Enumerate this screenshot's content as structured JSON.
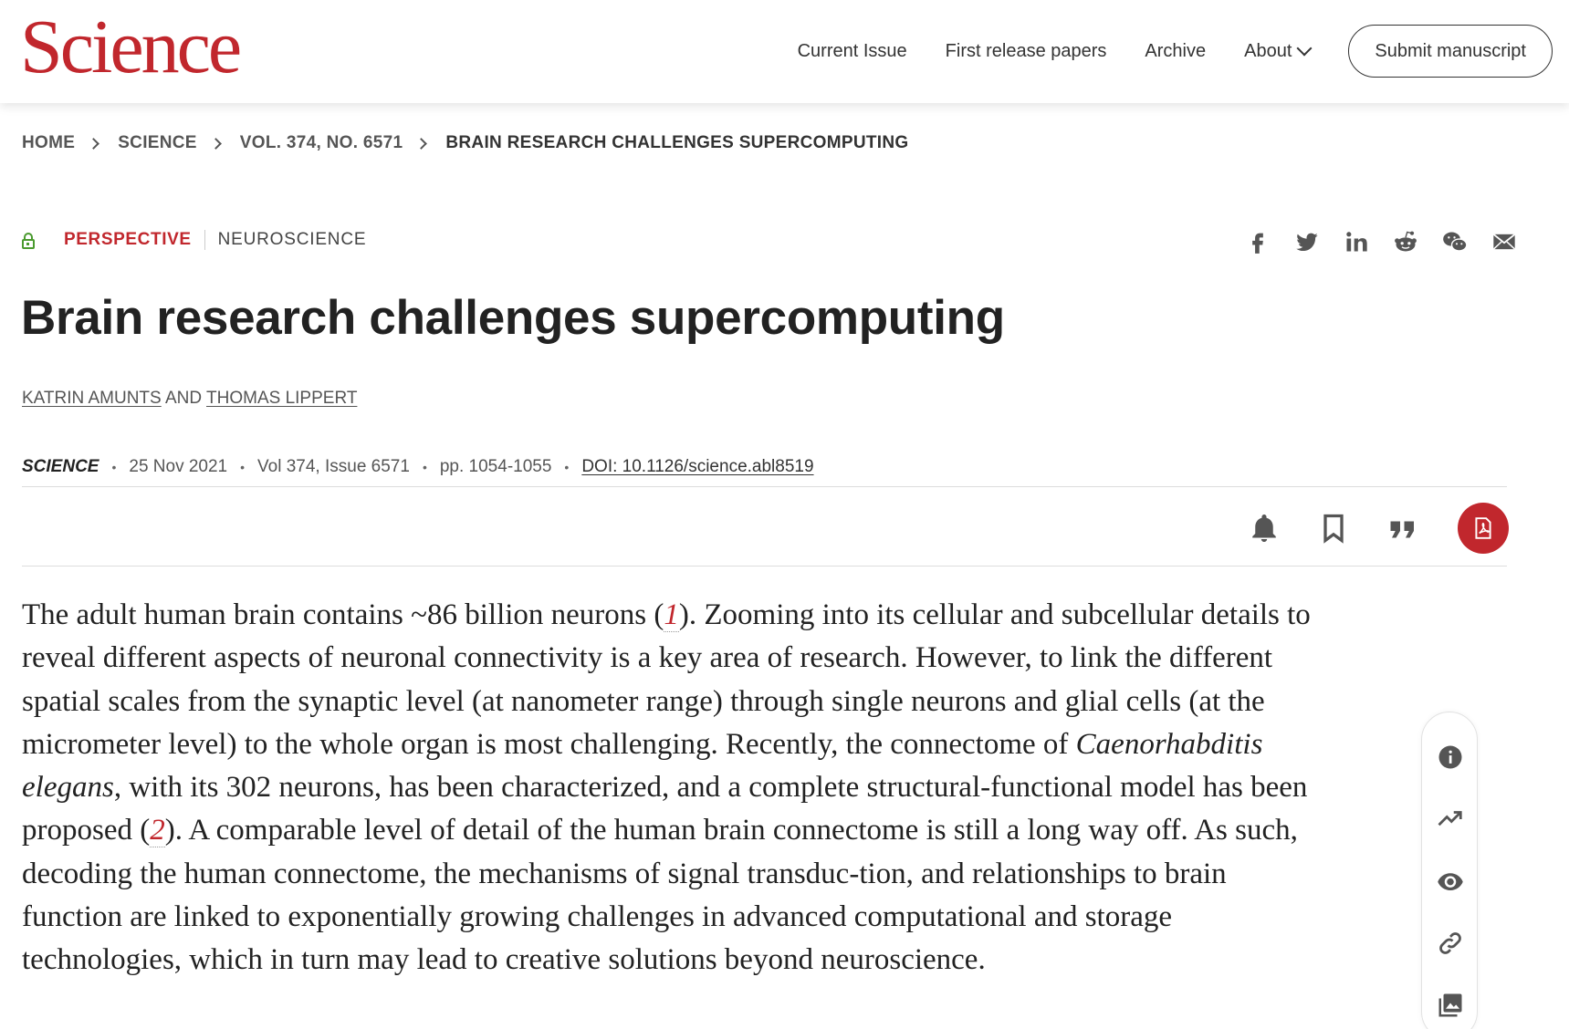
{
  "header": {
    "logo_text": "Science",
    "nav": [
      {
        "label": "Current Issue"
      },
      {
        "label": "First release papers"
      },
      {
        "label": "Archive"
      },
      {
        "label": "About"
      }
    ],
    "submit_label": "Submit manuscript"
  },
  "breadcrumb": {
    "items": [
      "HOME",
      "SCIENCE",
      "VOL. 374, NO. 6571",
      "BRAIN RESEARCH CHALLENGES SUPERCOMPUTING"
    ]
  },
  "article": {
    "type": "PERSPECTIVE",
    "subject": "NEUROSCIENCE",
    "title": "Brain research challenges supercomputing",
    "authors": [
      "KATRIN AMUNTS",
      "THOMAS LIPPERT"
    ],
    "author_joiner": "AND",
    "journal": "SCIENCE",
    "date": "25 Nov 2021",
    "volume_issue": "Vol 374, Issue 6571",
    "pages": "pp. 1054-1055",
    "doi": "DOI: 10.1126/science.abl8519",
    "abstract": {
      "p1": "The adult human brain contains ~86 billion neurons (",
      "ref1": "1",
      "p2": "). Zooming into its cellular and subcellular details to reveal different aspects of neuronal connectivity is a key area of research. However, to link the different spatial scales from the synaptic level (at nanometer range) through single neurons and glial cells (at the micrometer level) to the whole organ is most challenging. Recently, the connectome of ",
      "species": "Caenorhabditis elegans",
      "p3": ", with its 302 neurons, has been characterized, and a complete structural-functional model has been proposed (",
      "ref2": "2",
      "p4": "). A comparable level of detail of the human brain connectome is still a long way off. As such, decoding the human connectome, the mechanisms of signal transduc-tion, and relationships to brain function are linked to exponentially growing challenges in advanced computational and storage technologies, which in turn may lead to creative solutions beyond neuroscience."
    }
  },
  "share_icons": [
    "facebook-icon",
    "twitter-icon",
    "linkedin-icon",
    "reddit-icon",
    "wechat-icon",
    "email-icon"
  ],
  "action_icons": [
    "bell-icon",
    "bookmark-icon",
    "quote-icon",
    "pdf-icon"
  ],
  "side_icons": [
    "info-icon",
    "trending-icon",
    "eye-icon",
    "link-icon",
    "image-icon"
  ],
  "colors": {
    "brand": "#c1272d",
    "open_access": "#4a9a2e",
    "text": "#222222"
  }
}
